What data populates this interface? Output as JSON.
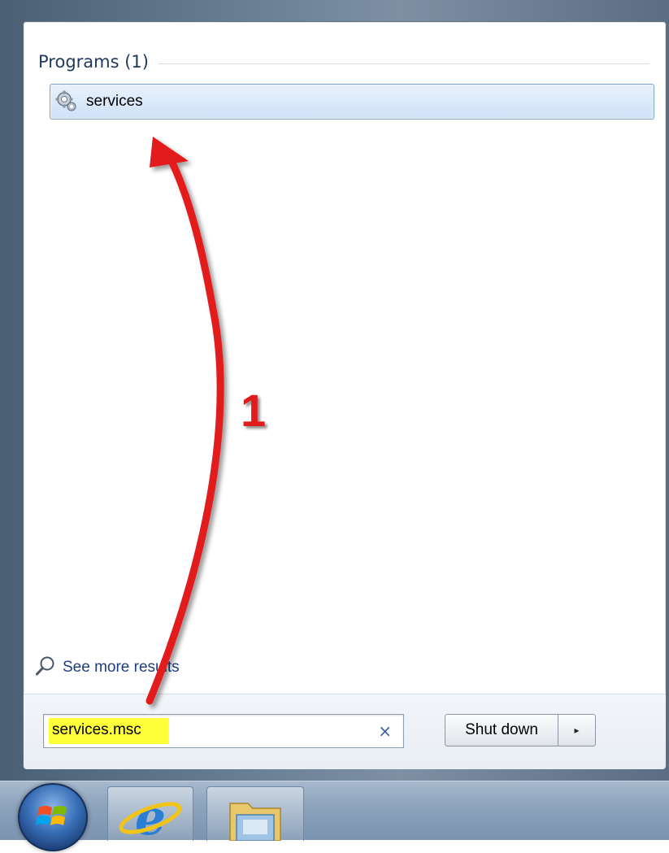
{
  "programs_section": {
    "heading": "Programs (1)",
    "results": [
      {
        "label": "services",
        "icon": "gear-icon"
      }
    ]
  },
  "see_more": {
    "label": "See more results",
    "icon": "magnifier-icon"
  },
  "search": {
    "value": "services.msc",
    "clear_icon": "×"
  },
  "shutdown": {
    "label": "Shut down",
    "arrow": "▸"
  },
  "annotation": {
    "step_number": "1",
    "color": "#e21b1b"
  },
  "taskbar": {
    "items": [
      "start-orb",
      "internet-explorer",
      "windows-explorer"
    ]
  }
}
